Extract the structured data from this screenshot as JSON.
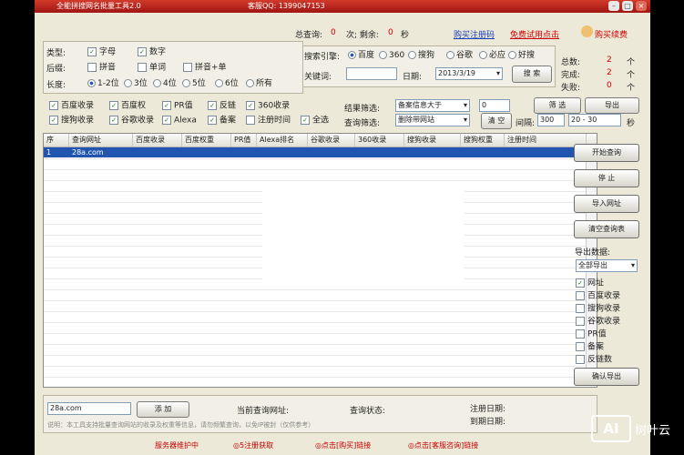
{
  "titlebar": {
    "title": "全能拼搜网名批量工具2.0",
    "qq": "客服QQ: 1399047153"
  },
  "header": {
    "count_label": "总查询:",
    "count_value": "0",
    "done_label": "次; 剩余:",
    "done_value": "0",
    "unit": "秒",
    "link1": "购买注册码",
    "link2": "免费试用点击",
    "link3": "购买续费"
  },
  "filters": {
    "label_type": "类型:",
    "label_domain": "后缀:",
    "label_len": "长度:",
    "type_opts": [
      "字母",
      "数字"
    ],
    "domain_opts": [
      "拼音",
      "单词",
      "拼音+单"
    ],
    "len_opts": [
      "1-2位",
      "3位",
      "4位",
      "5位",
      "6位",
      "所有"
    ]
  },
  "search": {
    "engine_label": "搜索引擎:",
    "engines": [
      "百度",
      "360",
      "搜狗",
      "谷歌",
      "必应",
      "好搜"
    ],
    "keyword_label": "关键词:",
    "keyword_value": "",
    "date_label": "日期:",
    "date_value": "2013/3/19",
    "search_btn": "搜 索"
  },
  "stats": {
    "total_label": "总数:",
    "total_value": "2",
    "done_label": "完成:",
    "done_value": "2",
    "fail_label": "失败:",
    "fail_value": "0",
    "unit": "个"
  },
  "options": {
    "row1": [
      "百度收录",
      "百度权",
      "PR值",
      "反链",
      "360收录"
    ],
    "row2": [
      "搜狗收录",
      "谷歌收录",
      "Alexa",
      "备案",
      "注册时间",
      "全选"
    ],
    "filter_label": "结果筛选:",
    "filter_value": "备案信息大于",
    "filter_num": "0",
    "query_label": "查询筛选:",
    "query_value": "删除带网站",
    "btn_filter": "筛 选",
    "btn_clear": "清 空",
    "btn_export": "导出",
    "range_label": "间隔:",
    "range_value": "300",
    "range_to": "20 - 30",
    "range_unit": "秒"
  },
  "table": {
    "columns": [
      "序",
      "查询网址",
      "百度收录",
      "百度权重",
      "PR值",
      "Alexa排名",
      "谷歌收录",
      "360收录",
      "搜狗收录",
      "搜狗权重",
      "注册时间"
    ],
    "selected_row": [
      "1",
      "28a.com"
    ]
  },
  "rightpanel": {
    "btn_start": "开始查询",
    "btn_stop": "停 止",
    "btn_import": "导入网址",
    "btn_clear": "清空查询表",
    "export_label": "导出数据:",
    "export_select": "全部导出",
    "checks": [
      "网址",
      "百度收录",
      "搜狗收录",
      "谷歌收录",
      "PR值",
      "备案",
      "反链数"
    ],
    "btn_confirm": "确认导出"
  },
  "bottom": {
    "input_value": "28a.com",
    "btn_add": "添 加",
    "info1": "当前查询网址:",
    "info2": "查询状态:",
    "info3": "注册日期:",
    "info4": "到期日期:",
    "note": "说明：本工具支持批量查询网站的收录及权重等信息，请勿频繁查询，以免IP被封（仅供参考）"
  },
  "footer": {
    "items": [
      "服务器维护中",
      "◎5注册获取",
      "◎点击[购买]链接",
      "◎点击[客服咨询]链接"
    ]
  },
  "watermark": {
    "logo": "AI",
    "text": "树叶云"
  }
}
